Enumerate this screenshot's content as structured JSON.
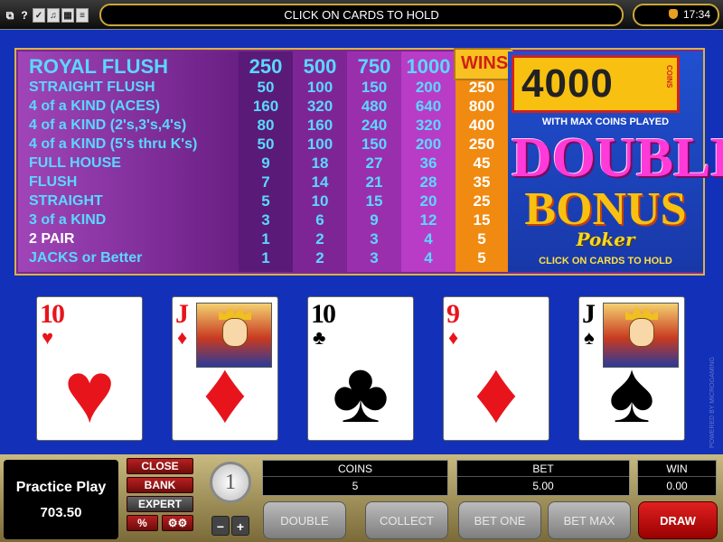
{
  "topbar": {
    "icons": [
      "?"
    ],
    "message": "CLICK ON CARDS TO HOLD",
    "clock": "17:34"
  },
  "paytable": {
    "wins_label": "WINS",
    "columns": [
      "250",
      "500",
      "750",
      "1000"
    ],
    "rows": [
      {
        "hand": "ROYAL FLUSH",
        "pays": [
          "250",
          "500",
          "750",
          "1000"
        ],
        "wins": ""
      },
      {
        "hand": "STRAIGHT FLUSH",
        "pays": [
          "50",
          "100",
          "150",
          "200"
        ],
        "wins": "250"
      },
      {
        "hand": "4 of a KIND (ACES)",
        "pays": [
          "160",
          "320",
          "480",
          "640"
        ],
        "wins": "800"
      },
      {
        "hand": "4 of a KIND (2's,3's,4's)",
        "pays": [
          "80",
          "160",
          "240",
          "320"
        ],
        "wins": "400"
      },
      {
        "hand": "4 of a KIND (5's thru K's)",
        "pays": [
          "50",
          "100",
          "150",
          "200"
        ],
        "wins": "250"
      },
      {
        "hand": "FULL HOUSE",
        "pays": [
          "9",
          "18",
          "27",
          "36"
        ],
        "wins": "45"
      },
      {
        "hand": "FLUSH",
        "pays": [
          "7",
          "14",
          "21",
          "28"
        ],
        "wins": "35"
      },
      {
        "hand": "STRAIGHT",
        "pays": [
          "5",
          "10",
          "15",
          "20"
        ],
        "wins": "25"
      },
      {
        "hand": "3 of a KIND",
        "pays": [
          "3",
          "6",
          "9",
          "12"
        ],
        "wins": "15"
      },
      {
        "hand": "2 PAIR",
        "pays": [
          "1",
          "2",
          "3",
          "4"
        ],
        "wins": "5"
      },
      {
        "hand": "JACKS or Better",
        "pays": [
          "1",
          "2",
          "3",
          "4"
        ],
        "wins": "5"
      }
    ]
  },
  "logo": {
    "jackpot": "4000",
    "coins_label": "COINS",
    "max_line": "WITH MAX COINS PLAYED",
    "line1": "DOUBLE",
    "line2": "BONUS",
    "line3": "Poker",
    "click_line": "CLICK ON CARDS TO HOLD"
  },
  "cards": [
    {
      "rank": "10",
      "suit": "♥",
      "color": "red"
    },
    {
      "rank": "J",
      "suit": "♦",
      "color": "red"
    },
    {
      "rank": "10",
      "suit": "♣",
      "color": "black"
    },
    {
      "rank": "9",
      "suit": "♦",
      "color": "red"
    },
    {
      "rank": "J",
      "suit": "♠",
      "color": "black"
    }
  ],
  "side_text": "POWERED BY MICROGAMING",
  "bottom": {
    "practice_label": "Practice Play",
    "balance": "703.50",
    "close": "CLOSE",
    "bank": "BANK",
    "expert": "EXPERT",
    "percent": "%",
    "coin_value": "1",
    "minus": "−",
    "plus": "+",
    "coins_label": "COINS",
    "coins_value": "5",
    "bet_label": "BET",
    "bet_value": "5.00",
    "win_label": "WIN",
    "win_value": "0.00",
    "double": "DOUBLE",
    "collect": "COLLECT",
    "bet_one": "BET ONE",
    "bet_max": "BET MAX",
    "draw": "DRAW"
  },
  "colors": {
    "field": "#1230b8",
    "wins_column": "#f08a10",
    "hand_text": "#5ad8ff",
    "draw_button": "#e02020"
  }
}
